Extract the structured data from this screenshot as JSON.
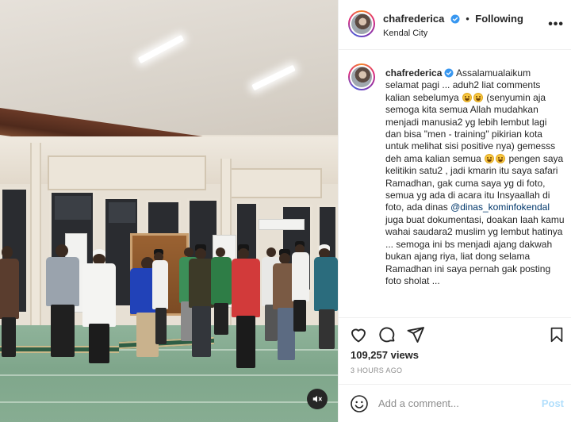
{
  "post": {
    "username": "chafrederica",
    "separator": "•",
    "follow_status": "Following",
    "location": "Kendal City",
    "more_label": "•••"
  },
  "caption": {
    "username": "chafrederica",
    "text_1": "Assalamualaikum selamat pagi ... aduh2 liat comments kalian sebelumya",
    "text_2": "(senyumin aja semoga kita semua Allah mudahkan menjadi manusia2 yg lebih lembut lagi dan bisa \"men - training\" pikirian kota untuk melihat sisi positive nya) gemesss deh ama kalian semua",
    "text_3": "pengen saya kelitikin satu2 , jadi kmarin itu saya safari Ramadhan, gak cuma saya yg di foto, semua yg ada di acara itu Insyaallah di foto, ada dinas",
    "mention": "@dinas_kominfokendal",
    "text_4": "juga buat dokumentasi, doakan laah kamu wahai saudara2 muslim yg lembut hatinya ... semoga ini bs menjadi ajang dakwah bukan ajang riya, liat dong selama Ramadhan ini saya pernah gak posting foto sholat ..."
  },
  "stats": {
    "views": "109,257 views",
    "time_ago": "3 HOURS AGO"
  },
  "comment_box": {
    "placeholder": "Add a comment...",
    "post_label": "Post"
  },
  "icons": {
    "like": "heart-icon",
    "comment": "comment-icon",
    "share": "paper-plane-icon",
    "save": "bookmark-icon",
    "mute": "speaker-muted-icon",
    "emoji": "smiley-icon",
    "verified": "verified-badge-icon"
  },
  "colors": {
    "verified": "#3897f0",
    "post_disabled": "#b2dffc",
    "mention": "#00376b"
  }
}
